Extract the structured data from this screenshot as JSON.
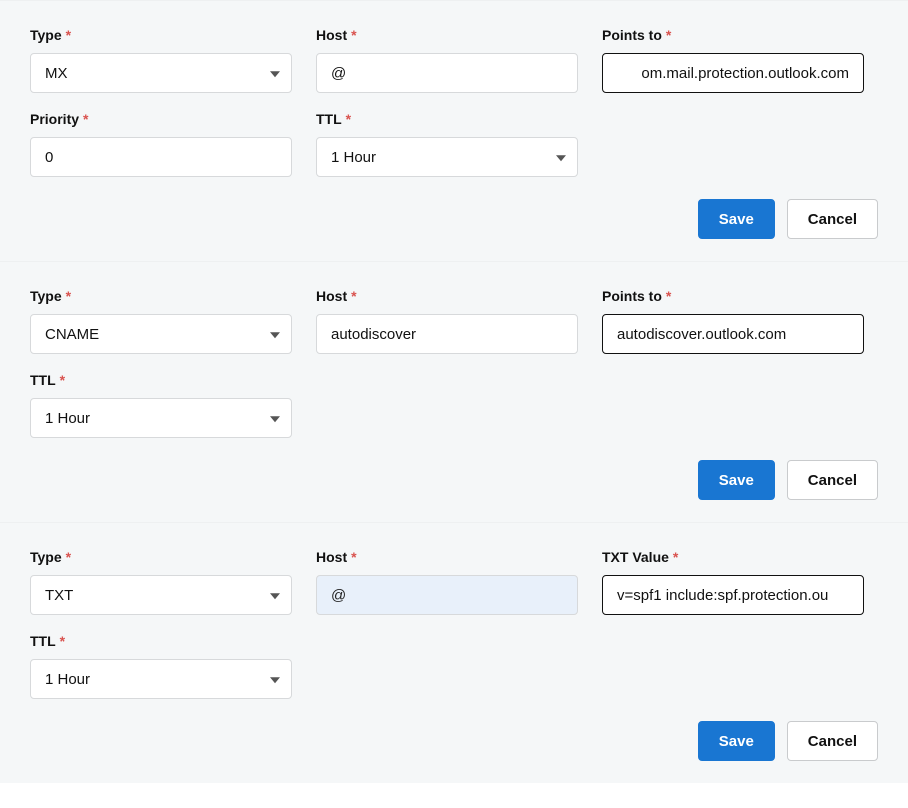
{
  "labels": {
    "type": "Type",
    "host": "Host",
    "points_to": "Points to",
    "priority": "Priority",
    "ttl": "TTL",
    "txt_value": "TXT Value",
    "save": "Save",
    "cancel": "Cancel"
  },
  "ttl_option": "1 Hour",
  "records": [
    {
      "type_option": "MX",
      "host": "@",
      "points_to": "om.mail.protection.outlook.com",
      "priority": "0",
      "ttl": "1 Hour"
    },
    {
      "type_option": "CNAME",
      "host": "autodiscover",
      "points_to": "autodiscover.outlook.com",
      "ttl": "1 Hour"
    },
    {
      "type_option": "TXT",
      "host": "@",
      "txt_value": "v=spf1 include:spf.protection.ou",
      "ttl": "1 Hour"
    }
  ]
}
